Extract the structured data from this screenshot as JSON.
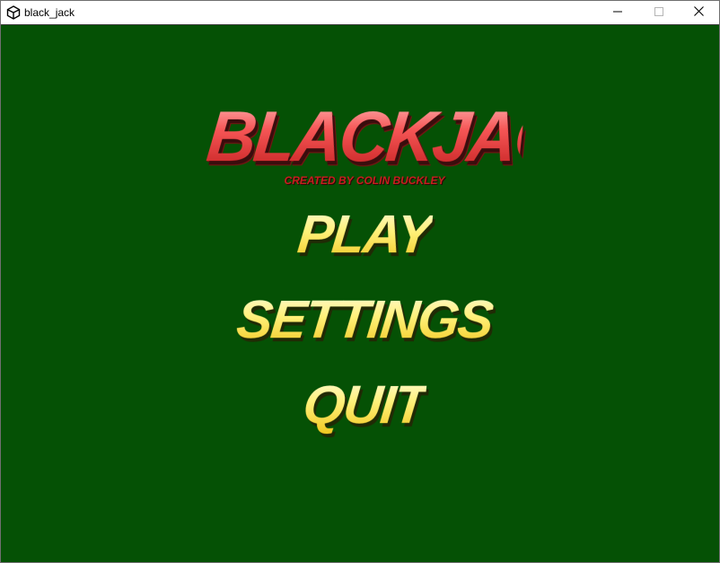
{
  "window": {
    "title": "black_jack",
    "icons": {
      "app": "unity-icon",
      "minimize": "minimize-icon",
      "maximize": "maximize-icon",
      "close": "close-icon"
    }
  },
  "game": {
    "background_color": "#055105",
    "logo": "BLACKJACK",
    "subtitle": "CREATED BY COLIN BUCKLEY",
    "menu": {
      "play": "PLAY",
      "settings": "SETTINGS",
      "quit": "QUIT"
    },
    "colors": {
      "logo": "#f05a5a",
      "menu_text": "#ffe45a"
    }
  }
}
